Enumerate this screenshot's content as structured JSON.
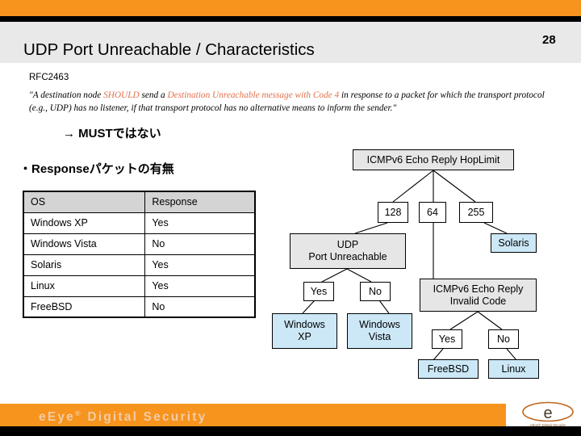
{
  "slide": {
    "title": "UDP Port Unreachable / Characteristics",
    "number": "28"
  },
  "rfc": {
    "label": "RFC2463",
    "quote_part1": "\"A destination node ",
    "quote_hl1": "SHOULD",
    "quote_part2": " send a ",
    "quote_hl2": "Destination Unreachable message with Code 4",
    "quote_part3": " in response to a packet for which the transport protocol (e.g., UDP) has no listener, if that transport protocol has no alternative means to inform the sender.\"",
    "conclusion": "→ MUSTではない"
  },
  "bullet": {
    "text": "・Responseパケットの有無"
  },
  "table": {
    "headers": [
      "OS",
      "Response"
    ],
    "rows": [
      [
        "Windows XP",
        "Yes"
      ],
      [
        "Windows Vista",
        "No"
      ],
      [
        "Solaris",
        "Yes"
      ],
      [
        "Linux",
        "Yes"
      ],
      [
        "FreeBSD",
        "No"
      ]
    ]
  },
  "tree": {
    "root": "ICMPv6 Echo Reply HopLimit",
    "hop_128": "128",
    "hop_64": "64",
    "hop_255": "255",
    "udp_line1": "UDP",
    "udp_line2": "Port Unreachable",
    "solaris": "Solaris",
    "udp_yes": "Yes",
    "udp_no": "No",
    "winxp_line1": "Windows",
    "winxp_line2": "XP",
    "vista_line1": "Windows",
    "vista_line2": "Vista",
    "invalid_line1": "ICMPv6 Echo Reply",
    "invalid_line2": "Invalid Code",
    "inv_yes": "Yes",
    "inv_no": "No",
    "freebsd": "FreeBSD",
    "linux": "Linux"
  },
  "footer": {
    "brand": "eEye",
    "brand_sup": "®",
    "brand_rest": " Digital Security",
    "logo_letter": "e",
    "logo_caption": "eEye® Digital Security"
  },
  "colors": {
    "orange": "#F7941E",
    "title_band": "#E9E9E9",
    "node_gray": "#E6E6E6",
    "node_blue": "#CCE8F7",
    "highlight": "#E2714A"
  }
}
